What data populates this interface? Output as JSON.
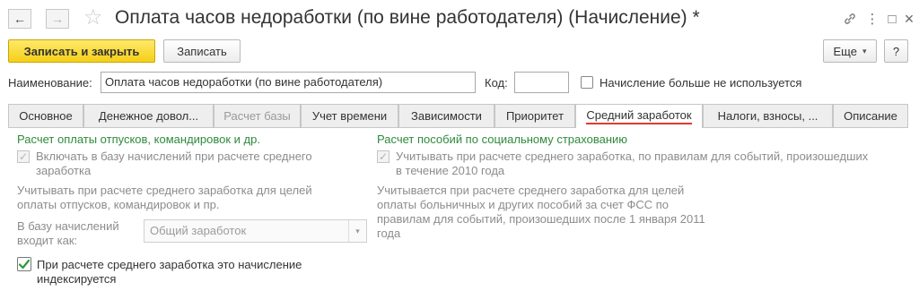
{
  "window": {
    "title": "Оплата часов недоработки (по вине работодателя) (Начисление) *",
    "back_icon": "←",
    "forward_icon": "→",
    "star_icon": "☆",
    "link_icon": "🔗",
    "menu_icon": "⋮",
    "restore_icon": "□",
    "close_icon": "×"
  },
  "toolbar": {
    "save_close_label": "Записать и закрыть",
    "save_label": "Записать",
    "more_label": "Еще",
    "more_arrow": "▾",
    "help_label": "?"
  },
  "form": {
    "name_label": "Наименование:",
    "name_value": "Оплата часов недоработки (по вине работодателя)",
    "code_label": "Код:",
    "code_value": "",
    "not_used_label": "Начисление больше не используется",
    "not_used_checked": false
  },
  "tabs": [
    {
      "label": "Основное",
      "state": "normal"
    },
    {
      "label": "Денежное довол...",
      "state": "normal"
    },
    {
      "label": "Расчет базы",
      "state": "disabled"
    },
    {
      "label": "Учет времени",
      "state": "normal"
    },
    {
      "label": "Зависимости",
      "state": "normal"
    },
    {
      "label": "Приоритет",
      "state": "normal"
    },
    {
      "label": "Средний заработок",
      "state": "active"
    },
    {
      "label": "Налоги, взносы, ...",
      "state": "normal"
    },
    {
      "label": "Описание",
      "state": "normal"
    }
  ],
  "left": {
    "section_title": "Расчет оплаты отпусков, командировок и др.",
    "include_label_1": "Включать в базу начислений при расчете среднего",
    "include_label_2": "заработка",
    "include_checked": true,
    "note_1": "Учитывать при расчете среднего заработка для целей",
    "note_2": "оплаты отпусков, командировок и пр.",
    "base_label_1": "В базу начислений",
    "base_label_2": "входит как:",
    "base_value": "Общий заработок",
    "base_arrow": "▾",
    "indexed_label_1": "При расчете среднего заработка это начисление",
    "indexed_label_2": "индексируется",
    "indexed_checked": true
  },
  "right": {
    "section_title": "Расчет пособий по социальному страхованию",
    "include_label_1": "Учитывать при расчете среднего заработка, по правилам для событий, произошедших",
    "include_label_2": "в течение 2010 года",
    "include_checked": true,
    "note_1": "Учитывается при расчете среднего заработка для целей",
    "note_2": "оплаты больничных и других пособий за счет ФСС по",
    "note_3": "правилам для событий, произошедших после 1 января 2011",
    "note_4": "года"
  },
  "colors": {
    "accent_yellow": "#f5cf16",
    "section_green": "#2f8a3c",
    "active_tab_underline": "#e13a2f",
    "checkmark_green": "#2b9a3a"
  }
}
